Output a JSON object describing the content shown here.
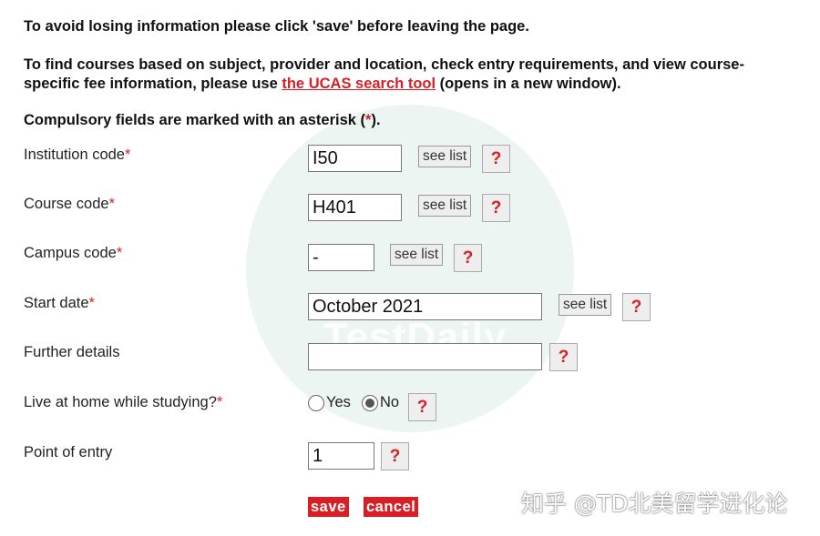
{
  "messages": {
    "save_notice": "To avoid losing information please click 'save' before leaving the page.",
    "search_before": "To find courses based on subject, provider and location, check entry requirements, and view course-",
    "search_line2_before": "specific fee information, please use ",
    "search_link": "the UCAS search tool",
    "search_after": " (opens in a new window).",
    "compulsory_before": "Compulsory fields are marked with an asterisk (",
    "compulsory_star": "*",
    "compulsory_after": ")."
  },
  "form": {
    "institution": {
      "label": "Institution code",
      "required": "*",
      "value": "I50",
      "see_list": "see list",
      "help": "?"
    },
    "course": {
      "label": "Course code",
      "required": "*",
      "value": "H401",
      "see_list": "see list",
      "help": "?"
    },
    "campus": {
      "label": "Campus code",
      "required": "*",
      "value": "-",
      "see_list": "see list",
      "help": "?"
    },
    "start_date": {
      "label": "Start date",
      "required": "*",
      "value": "October 2021",
      "see_list": "see list",
      "help": "?"
    },
    "further": {
      "label": "Further details",
      "value": "",
      "help": "?"
    },
    "live_home": {
      "label": "Live at home while studying?",
      "required": "*",
      "yes": "Yes",
      "no": "No",
      "selected": "No",
      "help": "?"
    },
    "point_entry": {
      "label": "Point of entry",
      "value": "1",
      "help": "?"
    }
  },
  "actions": {
    "save": "save",
    "cancel": "cancel"
  },
  "watermarks": {
    "center": "TestDaily",
    "corner": "知乎 @TD北美留学进化论"
  },
  "colors": {
    "accent_red": "#d81f26",
    "watermark_green": "#e6f2ee"
  }
}
